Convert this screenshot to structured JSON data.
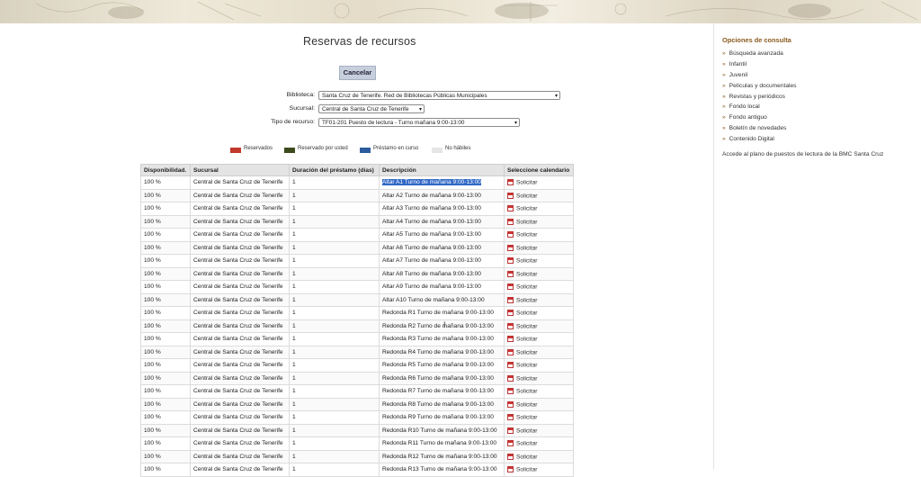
{
  "page": {
    "title": "Reservas de recursos",
    "cancel_label": "Cancelar"
  },
  "form": {
    "biblioteca": {
      "label": "Biblioteca:",
      "value": "Santa Cruz de Tenerife. Red de Bibliotecas Públicas Municipales"
    },
    "sucursal": {
      "label": "Sucursal:",
      "value": "Central de Santa Cruz de Tenerife"
    },
    "tipo": {
      "label": "Tipo de recurso:",
      "value": "TF01-201 Puesto de lectura - Turno mañana 9:00-13:00"
    }
  },
  "legend": [
    {
      "label": "Reservados",
      "color": "#c0392b"
    },
    {
      "label": "Reservado por usted",
      "color": "#3d4a1c"
    },
    {
      "label": "Préstamo en curso",
      "color": "#2a5c9e"
    },
    {
      "label": "No hábiles",
      "color": "#e6e6e6"
    }
  ],
  "table": {
    "headers": [
      "Disponibilidad.",
      "Sucursal",
      "Duración del préstamo (días)",
      "Descripción",
      "Seleccione calendario"
    ],
    "rows": [
      {
        "disp": "100 %",
        "sucursal": "Central de Santa Cruz de Tenerife",
        "dur": "1",
        "desc": "Altar A1 Turno de mañana 9:00-13:00",
        "action": "Solicitar"
      },
      {
        "disp": "100 %",
        "sucursal": "Central de Santa Cruz de Tenerife",
        "dur": "1",
        "desc": "Altar A2 Turno de mañana 9:00-13:00",
        "action": "Solicitar"
      },
      {
        "disp": "100 %",
        "sucursal": "Central de Santa Cruz de Tenerife",
        "dur": "1",
        "desc": "Altar A3 Turno de mañana 9:00-13:00",
        "action": "Solicitar"
      },
      {
        "disp": "100 %",
        "sucursal": "Central de Santa Cruz de Tenerife",
        "dur": "1",
        "desc": "Altar A4 Turno de mañana 9:00-13:00",
        "action": "Solicitar"
      },
      {
        "disp": "100 %",
        "sucursal": "Central de Santa Cruz de Tenerife",
        "dur": "1",
        "desc": "Altar A5 Turno de mañana 9:00-13:00",
        "action": "Solicitar"
      },
      {
        "disp": "100 %",
        "sucursal": "Central de Santa Cruz de Tenerife",
        "dur": "1",
        "desc": "Altar A6 Turno de mañana 9:00-13:00",
        "action": "Solicitar"
      },
      {
        "disp": "100 %",
        "sucursal": "Central de Santa Cruz de Tenerife",
        "dur": "1",
        "desc": "Altar A7 Turno de mañana 9:00-13:00",
        "action": "Solicitar"
      },
      {
        "disp": "100 %",
        "sucursal": "Central de Santa Cruz de Tenerife",
        "dur": "1",
        "desc": "Altar A8 Turno de mañana 9:00-13:00",
        "action": "Solicitar"
      },
      {
        "disp": "100 %",
        "sucursal": "Central de Santa Cruz de Tenerife",
        "dur": "1",
        "desc": "Altar A9 Turno de mañana 9:00-13:00",
        "action": "Solicitar"
      },
      {
        "disp": "100 %",
        "sucursal": "Central de Santa Cruz de Tenerife",
        "dur": "1",
        "desc": "Altar A10 Turno de mañana 9:00-13:00",
        "action": "Solicitar"
      },
      {
        "disp": "100 %",
        "sucursal": "Central de Santa Cruz de Tenerife",
        "dur": "1",
        "desc": "Redonda R1 Turno de mañana 9:00-13:00",
        "action": "Solicitar"
      },
      {
        "disp": "100 %",
        "sucursal": "Central de Santa Cruz de Tenerife",
        "dur": "1",
        "desc": "Redonda R2 Turno de mañana 9:00-13:00",
        "action": "Solicitar"
      },
      {
        "disp": "100 %",
        "sucursal": "Central de Santa Cruz de Tenerife",
        "dur": "1",
        "desc": "Redonda R3 Turno de mañana 9:00-13:00",
        "action": "Solicitar"
      },
      {
        "disp": "100 %",
        "sucursal": "Central de Santa Cruz de Tenerife",
        "dur": "1",
        "desc": "Redonda R4 Turno de mañana 9:00-13:00",
        "action": "Solicitar"
      },
      {
        "disp": "100 %",
        "sucursal": "Central de Santa Cruz de Tenerife",
        "dur": "1",
        "desc": "Redonda R5 Turno de mañana 9:00-13:00",
        "action": "Solicitar"
      },
      {
        "disp": "100 %",
        "sucursal": "Central de Santa Cruz de Tenerife",
        "dur": "1",
        "desc": "Redonda R6 Turno de mañana 9:00-13:00",
        "action": "Solicitar"
      },
      {
        "disp": "100 %",
        "sucursal": "Central de Santa Cruz de Tenerife",
        "dur": "1",
        "desc": "Redonda R7 Turno de mañana 9:00-13:00",
        "action": "Solicitar"
      },
      {
        "disp": "100 %",
        "sucursal": "Central de Santa Cruz de Tenerife",
        "dur": "1",
        "desc": "Redonda R8 Turno de mañana 9:00-13:00",
        "action": "Solicitar"
      },
      {
        "disp": "100 %",
        "sucursal": "Central de Santa Cruz de Tenerife",
        "dur": "1",
        "desc": "Redonda R9 Turno de mañana 9:00-13:00",
        "action": "Solicitar"
      },
      {
        "disp": "100 %",
        "sucursal": "Central de Santa Cruz de Tenerife",
        "dur": "1",
        "desc": "Redonda R10 Turno de mañana 9:00-13:00",
        "action": "Solicitar"
      },
      {
        "disp": "100 %",
        "sucursal": "Central de Santa Cruz de Tenerife",
        "dur": "1",
        "desc": "Redonda R11 Turno de mañana 9:00-13:00",
        "action": "Solicitar"
      },
      {
        "disp": "100 %",
        "sucursal": "Central de Santa Cruz de Tenerife",
        "dur": "1",
        "desc": "Redonda R12 Turno de mañana 9:00-13:00",
        "action": "Solicitar"
      },
      {
        "disp": "100 %",
        "sucursal": "Central de Santa Cruz de Tenerife",
        "dur": "1",
        "desc": "Redonda R13 Turno de mañana 9:00-13:00",
        "action": "Solicitar"
      }
    ]
  },
  "sidebar": {
    "title": "Opciones de consulta",
    "items": [
      "Búsqueda avanzada",
      "Infantil",
      "Juvenil",
      "Películas y documentales",
      "Revistas y periódicos",
      "Fondo local",
      "Fondo antiguo",
      "Boletín de novedades",
      "Contenido Digital"
    ],
    "plan_link": "Accede al plano de puestos de lectura de la BMC Santa Cruz"
  },
  "colors": {
    "accent": "#8b5a1e",
    "selection": "#3169c6",
    "button": "#c7cfdc"
  }
}
